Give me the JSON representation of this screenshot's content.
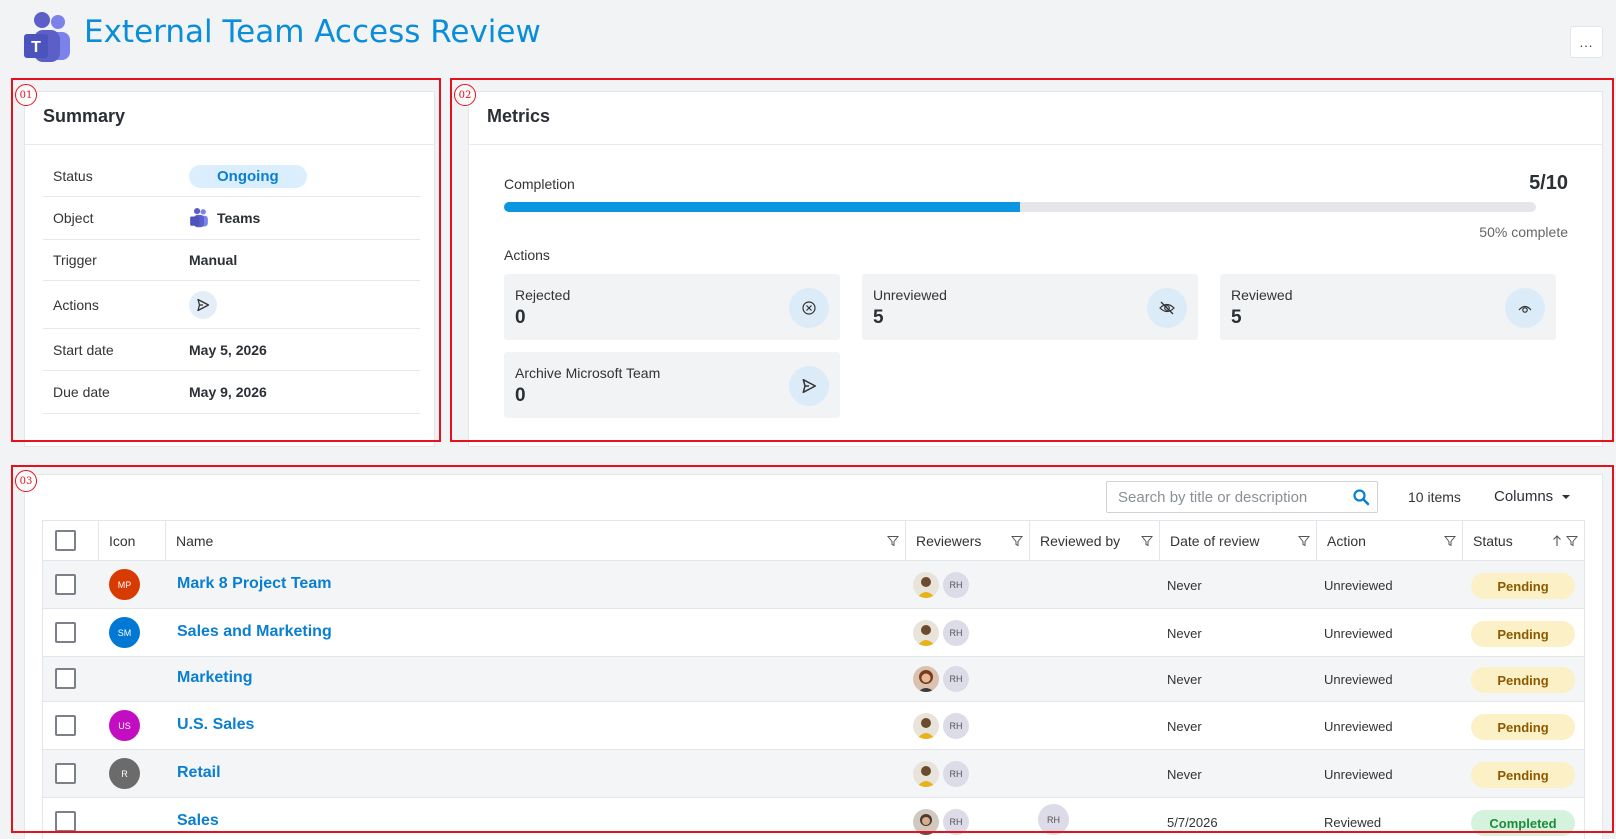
{
  "header": {
    "title": "External Team Access Review",
    "more_label": "..."
  },
  "annotations": [
    "01",
    "02",
    "03"
  ],
  "summary": {
    "title": "Summary",
    "rows": [
      {
        "label": "Status",
        "value": "Ongoing"
      },
      {
        "label": "Object",
        "value": "Teams"
      },
      {
        "label": "Trigger",
        "value": "Manual"
      },
      {
        "label": "Actions",
        "value": ""
      },
      {
        "label": "Start date",
        "value": "May 5, 2026"
      },
      {
        "label": "Due date",
        "value": "May 9, 2026"
      }
    ]
  },
  "metrics": {
    "title": "Metrics",
    "completion_label": "Completion",
    "completion_ratio": "5/10",
    "completion_fraction": 0.5,
    "completion_text": "50% complete",
    "actions_label": "Actions",
    "tiles": [
      {
        "label": "Rejected",
        "value": "0",
        "icon": "reject-circle-icon"
      },
      {
        "label": "Unreviewed",
        "value": "5",
        "icon": "eye-off-icon"
      },
      {
        "label": "Reviewed",
        "value": "5",
        "icon": "eye-icon"
      },
      {
        "label": "Archive Microsoft Team",
        "value": "0",
        "icon": "send-icon"
      }
    ]
  },
  "table": {
    "search_placeholder": "Search by title or description",
    "items_count": "10 items",
    "columns_label": "Columns",
    "headers": {
      "icon": "Icon",
      "name": "Name",
      "reviewers": "Reviewers",
      "reviewed_by": "Reviewed by",
      "date": "Date of review",
      "action": "Action",
      "status": "Status"
    },
    "rows": [
      {
        "initials": "MP",
        "color": "#d83b01",
        "name": "Mark 8 Project Team",
        "reviewer": "RH",
        "reviewed_by": "",
        "date": "Never",
        "action": "Unreviewed",
        "status": "Pending"
      },
      {
        "initials": "SM",
        "color": "#0078d4",
        "name": "Sales and Marketing",
        "reviewer": "RH",
        "reviewed_by": "",
        "date": "Never",
        "action": "Unreviewed",
        "status": "Pending"
      },
      {
        "initials": "",
        "color": "",
        "name": "Marketing",
        "reviewer": "RH",
        "reviewed_by": "",
        "date": "Never",
        "action": "Unreviewed",
        "status": "Pending"
      },
      {
        "initials": "US",
        "color": "#c30dc3",
        "name": "U.S. Sales",
        "reviewer": "RH",
        "reviewed_by": "",
        "date": "Never",
        "action": "Unreviewed",
        "status": "Pending"
      },
      {
        "initials": "R",
        "color": "#6b6b6b",
        "name": "Retail",
        "reviewer": "RH",
        "reviewed_by": "",
        "date": "Never",
        "action": "Unreviewed",
        "status": "Pending"
      },
      {
        "initials": "",
        "color": "",
        "name": "Sales",
        "reviewer": "RH",
        "reviewed_by": "RH",
        "date": "5/7/2026",
        "action": "Reviewed",
        "status": "Completed"
      }
    ]
  }
}
